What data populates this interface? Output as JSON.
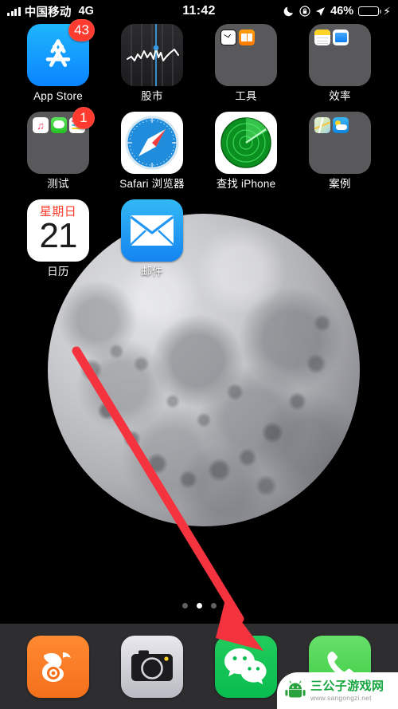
{
  "status_bar": {
    "signal_icon": "signal-bars-icon",
    "carrier": "中国移动",
    "network": "4G",
    "time": "11:42",
    "do_not_disturb_icon": "moon-icon",
    "rotation_lock_icon": "rotation-lock-icon",
    "location_icon": "location-arrow-icon",
    "battery_percent": "46%",
    "battery_level": 46,
    "battery_fill_color": "#4cd964",
    "charging_icon": "lightning-bolt-icon"
  },
  "home_screen": {
    "rows": [
      [
        {
          "name": "app-store",
          "label": "App Store",
          "badge": "43",
          "icon": "app-store-icon"
        },
        {
          "name": "stocks",
          "label": "股市",
          "badge": null,
          "icon": "stocks-icon"
        },
        {
          "name": "tools-folder",
          "label": "工具",
          "badge": null,
          "icon": "folder-icon",
          "contents": [
            "clock-icon",
            "books-icon"
          ]
        },
        {
          "name": "productivity-folder",
          "label": "效率",
          "badge": null,
          "icon": "folder-icon",
          "contents": [
            "notes-icon",
            "files-icon"
          ]
        }
      ],
      [
        {
          "name": "test-folder",
          "label": "测试",
          "badge": "1",
          "icon": "folder-icon",
          "contents": [
            "music-icon",
            "messages-icon",
            "shortcuts-icon"
          ]
        },
        {
          "name": "safari",
          "label": "Safari 浏览器",
          "badge": null,
          "icon": "safari-compass-icon"
        },
        {
          "name": "find-iphone",
          "label": "查找 iPhone",
          "badge": null,
          "icon": "find-iphone-radar-icon"
        },
        {
          "name": "cases-folder",
          "label": "案例",
          "badge": null,
          "icon": "folder-icon",
          "contents": [
            "maps-icon",
            "weather-icon"
          ]
        }
      ],
      [
        {
          "name": "calendar",
          "label": "日历",
          "badge": null,
          "icon": "calendar-icon",
          "calendar_weekday": "星期日",
          "calendar_day": "21"
        },
        {
          "name": "mail",
          "label": "邮件",
          "badge": null,
          "icon": "mail-envelope-icon"
        },
        {
          "name": "empty-slot-3",
          "label": "",
          "badge": null,
          "icon": null
        },
        {
          "name": "empty-slot-4",
          "label": "",
          "badge": null,
          "icon": null
        }
      ]
    ]
  },
  "page_dots": {
    "count": 3,
    "active_index": 1
  },
  "dock": {
    "items": [
      {
        "name": "uc-browser",
        "icon": "uc-browser-squirrel-icon"
      },
      {
        "name": "camera",
        "icon": "camera-icon"
      },
      {
        "name": "wechat",
        "icon": "wechat-chat-bubbles-icon"
      },
      {
        "name": "phone",
        "icon": "phone-handset-icon"
      }
    ]
  },
  "annotation": {
    "arrow_color": "#f5333f",
    "arrow_icon": "red-pointer-arrow",
    "points_to": "wechat"
  },
  "watermark": {
    "logo_icon": "android-robot-icon",
    "title": "三公子游戏网",
    "url": "www.sangongzi.net",
    "brand_color": "#17a63f"
  }
}
